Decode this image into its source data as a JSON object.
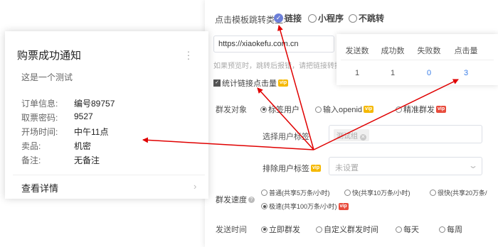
{
  "jump": {
    "label": "点击模板跳转类型:",
    "options": [
      {
        "label": "链接",
        "selected": true
      },
      {
        "label": "小程序",
        "selected": false
      },
      {
        "label": "不跳转",
        "selected": false
      }
    ]
  },
  "url": {
    "value": "https://xiaokefu.com.cn",
    "hint": "如果预览时，跳转后报错，请把链接转换为"
  },
  "track": {
    "label": "统计链接点击量",
    "checked": true,
    "vip": "vip"
  },
  "audience": {
    "label": "群发对象",
    "options": [
      {
        "label": "标签用户",
        "selected": true,
        "vip": ""
      },
      {
        "label": "输入openid",
        "selected": false,
        "vip": "vip"
      },
      {
        "label": "精准群发",
        "selected": false,
        "vip": "vip"
      }
    ]
  },
  "select_tag": {
    "label": "选择用户标签",
    "chip": "测试组"
  },
  "exclude_tag": {
    "label": "排除用户标签",
    "vip": "vip",
    "placeholder": "未设置"
  },
  "speed": {
    "label": "群发速度",
    "options": [
      {
        "label": "普通(共享5万条/小时)",
        "selected": false
      },
      {
        "label": "快(共享10万条/小时)",
        "selected": false
      },
      {
        "label": "很快(共享20万条/",
        "selected": false
      },
      {
        "label": "极速(共享100万条/小时)",
        "selected": true
      }
    ]
  },
  "send_time": {
    "label": "发送时间",
    "options": [
      {
        "label": "立即群发",
        "selected": true
      },
      {
        "label": "自定义群发时间",
        "selected": false
      },
      {
        "label": "每天",
        "selected": false
      },
      {
        "label": "每周",
        "selected": false
      }
    ]
  },
  "card": {
    "title": "购票成功通知",
    "subtitle": "这是一个测试",
    "fields": [
      {
        "key": "订单信息:",
        "value": "编号89757"
      },
      {
        "key": "取票密码:",
        "value": "9527"
      },
      {
        "key": "开场时间:",
        "value": "中午11点"
      },
      {
        "key": "卖品:",
        "value": "机密"
      },
      {
        "key": "备注:",
        "value": "无备注"
      }
    ],
    "link": "查看详情",
    "arrow": "›"
  },
  "stats": {
    "headers": [
      "发送数",
      "成功数",
      "失败数",
      "点击量"
    ],
    "values": [
      "1",
      "1",
      "0",
      "3"
    ]
  },
  "colors": {
    "arrow": "#e00000",
    "link_blue": "#3a7ee8",
    "vip_gold": "#f5b800",
    "vip_red": "#e84b3c"
  }
}
